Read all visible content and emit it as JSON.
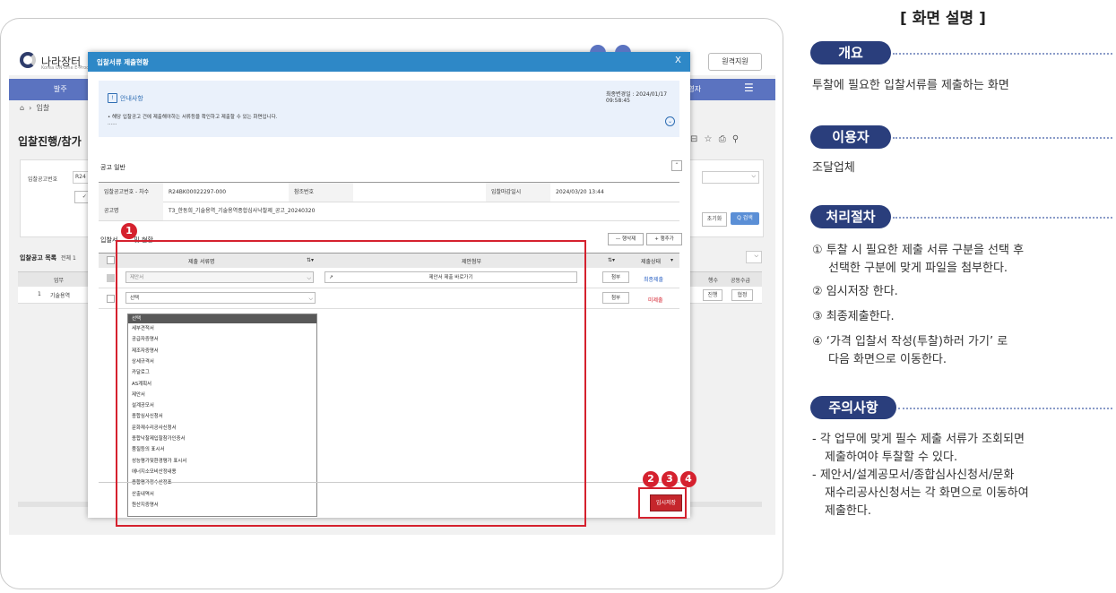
{
  "app": {
    "logo": "나라장터",
    "logo_sub": "Korea ON-Line E-Procurement",
    "support_button": "원격지원",
    "nav_first": "발주",
    "nav_right": "운영자",
    "breadcrumb": "입찰",
    "page_title": "입찰진행/참가",
    "filter": {
      "notice_no_label": "입찰공고번호",
      "notice_no_value": "R24",
      "check_label": "✓ 공",
      "reset_button": "초기화",
      "search_button": "Q 검색"
    },
    "list": {
      "title": "입찰공고 목록",
      "count_label": "전체 1",
      "headers": [
        "업무",
        "행수",
        "공동수급"
      ],
      "row": {
        "no": "1",
        "task": "기술용역",
        "btn1": "진행",
        "btn2": "협정"
      }
    }
  },
  "modal": {
    "title": "입찰서류 제출현황",
    "close": "X",
    "guide": {
      "title": "안내사항",
      "updated": "최종변경일 : 2024/01/17 09:58:45",
      "text": "• 해당 입찰공고 건에 제출해야하는 서류등을 확인하고 제출할 수 있는 화면입니다.",
      "more": "......"
    },
    "notice_section": {
      "title": "공고 일반",
      "notice_no_label": "입찰공고번호 - 차수",
      "notice_no_value": "R24BK00022297-000",
      "ref_no_label": "참조번호",
      "ref_no_value": "",
      "deadline_label": "입찰마감일시",
      "deadline_value": "2024/03/20 13:44",
      "name_label": "공고명",
      "name_value": "T3_한동희_기술용역_기술용역종합심사낙찰제_공고_20240320"
    },
    "docs_section": {
      "title": "입찰서",
      "title_suffix": "및 현황",
      "delete_row": "— 행삭제",
      "add_row": "+ 행추가",
      "headers": {
        "doc_name": "제출 서류명",
        "attach": "제안첨부",
        "status": "제출상태"
      },
      "rows": [
        {
          "doc": "제안서",
          "link": "제안서 제출 바로가기",
          "attach": "첨부",
          "status": "최종제출",
          "status_color": "#2b62c4"
        },
        {
          "doc": "선택",
          "link": "",
          "attach": "첨부",
          "status": "미제출",
          "status_color": "#d5212e"
        }
      ]
    },
    "dropdown_options": [
      "선택",
      "세부견적서",
      "공급자증명서",
      "제조자증명서",
      "상세규격서",
      "카달로그",
      "AS계획서",
      "제안서",
      "설계공모서",
      "종합심사신청서",
      "문화재수리공사신청서",
      "종합낙찰제입찰참가인증서",
      "품질등의 표시서",
      "성능평가및환경평가 표시서",
      "에너지소모비산정내용",
      "종합평가정수산정표",
      "산출내역서",
      "원산지증명서"
    ],
    "save_button": "임시저장"
  },
  "badges": {
    "one": "1",
    "two": "2",
    "three": "3",
    "four": "4"
  },
  "explain": {
    "title": "[ 화면 설명 ]",
    "overview_label": "개요",
    "overview_text": "투찰에 필요한 입찰서류를 제출하는 화면",
    "user_label": "이용자",
    "user_text": "조달업체",
    "process_label": "처리절차",
    "steps": [
      "① 투찰 시 필요한 제출 서류 구분을 선택 후",
      "선택한 구분에 맞게 파일을 첨부한다.",
      "② 임시저장 한다.",
      "③ 최종제출한다.",
      "④ ‘가격 입찰서 작성(투찰)하러 가기’ 로",
      "다음 화면으로 이동한다."
    ],
    "caution_label": "주의사항",
    "cautions": [
      "- 각 업무에 맞게 필수 제출 서류가 조회되면",
      "제출하여야 투찰할 수 있다.",
      "- 제안서/설계공모서/종합심사신청서/문화",
      "재수리공사신청서는 각 화면으로 이동하여",
      "제출한다."
    ]
  }
}
